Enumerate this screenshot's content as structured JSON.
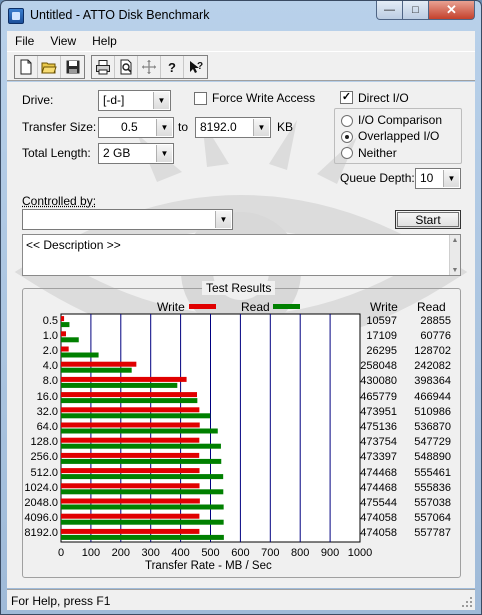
{
  "window": {
    "title": "Untitled - ATTO Disk Benchmark"
  },
  "menu": [
    "File",
    "View",
    "Help"
  ],
  "toolbar_icons": [
    "new-file-icon",
    "open-folder-icon",
    "save-icon",
    "print-icon",
    "print-preview-icon",
    "move-icon",
    "help-icon",
    "context-help-icon"
  ],
  "form": {
    "drive_label": "Drive:",
    "drive_value": "[-d-]",
    "force_write_label": "Force Write Access",
    "force_write_checked": false,
    "direct_io_label": "Direct I/O",
    "direct_io_checked": true,
    "transfer_size_label": "Transfer Size:",
    "transfer_from": "0.5",
    "to_label": "to",
    "transfer_to": "8192.0",
    "kb_label": "KB",
    "total_length_label": "Total Length:",
    "total_length_value": "2 GB",
    "io_options": [
      {
        "label": "I/O Comparison",
        "selected": false
      },
      {
        "label": "Overlapped I/O",
        "selected": true
      },
      {
        "label": "Neither",
        "selected": false
      }
    ],
    "queue_depth_label": "Queue Depth:",
    "queue_depth_value": "10",
    "controlled_by_label": "Controlled by:",
    "controlled_by_value": "",
    "start_label": "Start",
    "description_text": "<< Description >>"
  },
  "results": {
    "title": "Test Results",
    "write_legend": "Write",
    "read_legend": "Read",
    "write_col": "Write",
    "read_col": "Read",
    "write_values": [
      "10597",
      "17109",
      "26295",
      "258048",
      "430080",
      "465779",
      "473951",
      "475136",
      "473754",
      "473397",
      "474468",
      "474468",
      "475544",
      "474058",
      "474058"
    ],
    "read_values": [
      "28855",
      "60776",
      "128702",
      "242082",
      "398364",
      "466944",
      "510986",
      "536870",
      "547729",
      "548890",
      "555461",
      "555836",
      "557038",
      "557064",
      "557787"
    ],
    "xlabel": "Transfer Rate - MB / Sec"
  },
  "chart_data": {
    "type": "bar",
    "orientation": "horizontal",
    "categories": [
      "0.5",
      "1.0",
      "2.0",
      "4.0",
      "8.0",
      "16.0",
      "32.0",
      "64.0",
      "128.0",
      "256.0",
      "512.0",
      "1024.0",
      "2048.0",
      "4096.0",
      "8192.0"
    ],
    "series": [
      {
        "name": "Write",
        "color": "#e00000",
        "values": [
          10.3,
          16.7,
          25.7,
          252.0,
          420.0,
          454.9,
          462.8,
          464.0,
          462.7,
          462.3,
          463.3,
          463.3,
          464.4,
          462.9,
          462.9
        ]
      },
      {
        "name": "Read",
        "color": "#008000",
        "values": [
          28.2,
          59.4,
          125.7,
          236.4,
          389.0,
          456.0,
          499.0,
          524.3,
          534.9,
          536.0,
          542.4,
          542.8,
          544.0,
          544.0,
          544.7
        ]
      }
    ],
    "xticks": [
      "0",
      "100",
      "200",
      "300",
      "400",
      "500",
      "600",
      "700",
      "800",
      "900",
      "1000"
    ],
    "xlim": [
      0,
      1000
    ],
    "xlabel": "Transfer Rate - MB / Sec",
    "legend": "top",
    "grid": true
  },
  "status": {
    "text": "For Help, press F1"
  }
}
